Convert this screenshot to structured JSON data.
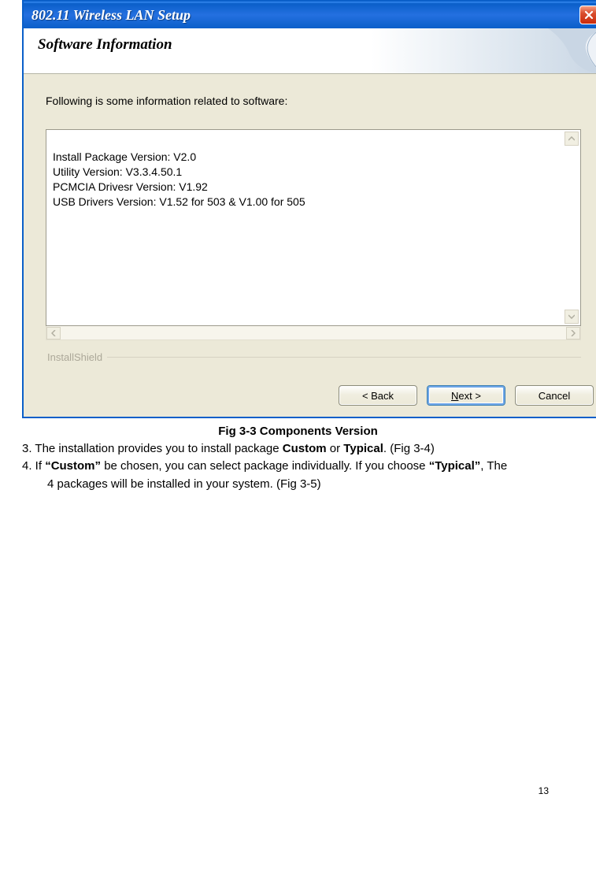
{
  "dialog": {
    "title": "802.11  Wireless LAN Setup",
    "header": "Software Information",
    "intro": "Following is some information related to software:",
    "info_lines": "Install Package Version: V2.0\nUtility Version: V3.3.4.50.1\nPCMCIA Drivesr Version: V1.92\nUSB Drivers Version: V1.52 for 503 & V1.00 for 505",
    "shield_label": "InstallShield",
    "buttons": {
      "back": "< Back",
      "next_prefix": "N",
      "next_rest": "ext >",
      "cancel": "Cancel"
    }
  },
  "doc": {
    "caption": "Fig 3-3 Components Version",
    "line3_a": "3. The installation provides you to install package ",
    "line3_custom": "Custom",
    "line3_or": " or ",
    "line3_typical": "Typical",
    "line3_b": ". (Fig 3-4)",
    "line4_a": "4. If ",
    "line4_custom_q": "“Custom”",
    "line4_b": " be chosen, you can select package individually. If you choose ",
    "line4_typical_q": "“Typical”",
    "line4_c": ", The",
    "line4_d": "4 packages will be installed in your system. (Fig 3-5)",
    "page_number": "13"
  }
}
